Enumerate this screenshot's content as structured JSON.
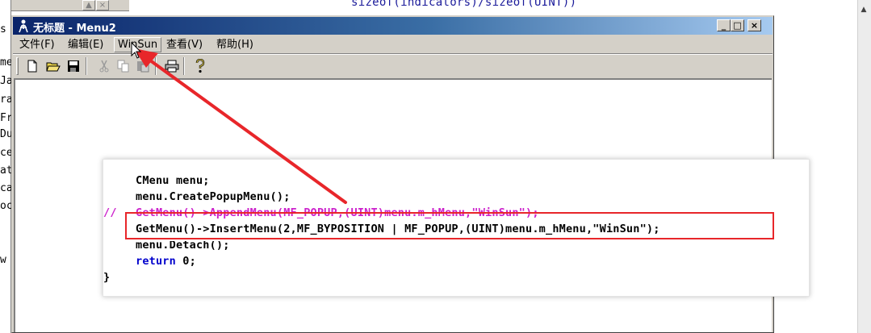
{
  "ide": {
    "code_top": "sizeof(indicators)/sizeof(UINT))",
    "left_fragments": [
      "s",
      "me",
      "Ja",
      "ra",
      "Fr",
      "Du",
      "ce",
      "at",
      "ca",
      "oc",
      "w"
    ]
  },
  "window": {
    "title": "无标题 - Menu2",
    "buttons": [
      "_",
      "□",
      "×"
    ],
    "menu": [
      "文件(F)",
      "编辑(E)",
      "WinSun",
      "查看(V)",
      "帮助(H)"
    ],
    "toolbar": [
      "new-file-icon",
      "open-folder-icon",
      "save-icon",
      "cut-icon",
      "copy-icon",
      "paste-icon",
      "print-icon",
      "help-icon"
    ]
  },
  "code": {
    "line1": "CMenu menu;",
    "line2": "menu.CreatePopupMenu();",
    "line3_comment": "//",
    "line3": "GetMenu()->AppendMenu(MF_POPUP,(UINT)menu.m_hMenu,\"WinSun\");",
    "line4": "GetMenu()->InsertMenu(2,MF_BYPOSITION | MF_POPUP,(UINT)menu.m_hMenu,\"WinSun\");",
    "line5": "menu.Detach();",
    "line6_keyword": "return",
    "line6_rest": " 0;",
    "line7": "}"
  },
  "colors": {
    "annotation_red": "#e8262a",
    "keyword_blue": "#0000cc",
    "comment_magenta": "#cc22cc",
    "titlebar_start": "#0a246a"
  }
}
